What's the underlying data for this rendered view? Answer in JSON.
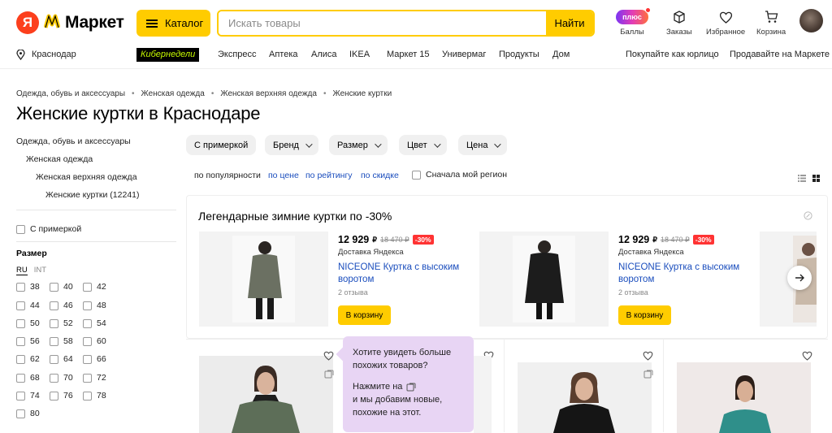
{
  "header": {
    "logo_letter": "Я",
    "logo_text": "Маркет",
    "catalog_label": "Каталог",
    "search_placeholder": "Искать товары",
    "search_button": "Найти",
    "plus_badge": "плюс",
    "actions": [
      {
        "name": "points",
        "label": "Баллы",
        "icon": "plus-badge-icon"
      },
      {
        "name": "orders",
        "label": "Заказы",
        "icon": "box-icon"
      },
      {
        "name": "favorites",
        "label": "Избранное",
        "icon": "heart-icon"
      },
      {
        "name": "cart",
        "label": "Корзина",
        "icon": "cart-icon"
      }
    ]
  },
  "nav": {
    "city": "Краснодар",
    "items": [
      "Кибернедели",
      "Экспресс",
      "Аптека",
      "Алиса",
      "IKEA",
      "Маркет 15",
      "Универмаг",
      "Продукты",
      "Дом"
    ],
    "right_items": [
      "Покупайте как юрлицо",
      "Продавайте на Маркете"
    ]
  },
  "breadcrumbs": [
    "Одежда, обувь и аксессуары",
    "Женская одежда",
    "Женская верхняя одежда",
    "Женские куртки"
  ],
  "page_title": "Женские куртки в Краснодаре",
  "sidebar": {
    "categories": [
      "Одежда, обувь и аксессуары",
      "Женская одежда",
      "Женская верхняя одежда",
      "Женские куртки (12241)"
    ],
    "fitting_label": "С примеркой",
    "size_title": "Размер",
    "size_tabs": [
      "RU",
      "INT"
    ],
    "sizes": [
      "38",
      "40",
      "42",
      "44",
      "46",
      "48",
      "50",
      "52",
      "54",
      "56",
      "58",
      "60",
      "62",
      "64",
      "66",
      "68",
      "70",
      "72",
      "74",
      "76",
      "78",
      "80"
    ]
  },
  "filters": {
    "chips": [
      "С примеркой",
      "Бренд",
      "Размер",
      "Цвет",
      "Цена"
    ],
    "sort": [
      "по популярности",
      "по цене",
      "по рейтингу",
      "по скидке"
    ],
    "region_label": "Сначала мой регион"
  },
  "promo": {
    "title": "Легендарные зимние куртки по -30%",
    "products": [
      {
        "price": "12 929",
        "currency": "₽",
        "old_price": "18 470 ₽",
        "discount": "-30%",
        "delivery": "Доставка Яндекса",
        "title": "NICEONE Куртка с высоким воротом",
        "reviews": "2 отзыва",
        "cart_button": "В корзину",
        "jacket_color": "#6b7062"
      },
      {
        "price": "12 929",
        "currency": "₽",
        "old_price": "18 470 ₽",
        "discount": "-30%",
        "delivery": "Доставка Яндекса",
        "title": "NICEONE Куртка с высоким воротом",
        "reviews": "2 отзыва",
        "cart_button": "В корзину",
        "jacket_color": "#1c1c1c"
      }
    ]
  },
  "tooltip": {
    "line1": "Хотите увидеть больше похожих товаров?",
    "line2_prefix": "Нажмите на",
    "line3": "и мы добавим новые, похожие на этот."
  },
  "colors": {
    "accent": "#ffcc00",
    "link": "#1a4dbd",
    "discount": "#ff3333",
    "cyber_text": "#c6f800"
  }
}
